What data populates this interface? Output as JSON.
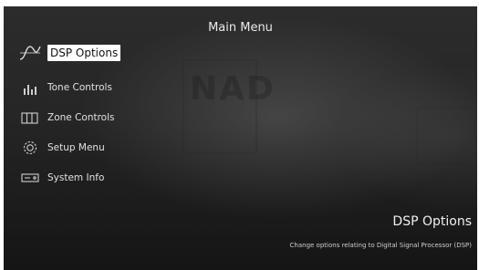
{
  "screen": {
    "title": "Main Menu"
  },
  "menu": {
    "items": [
      {
        "label": "DSP Options",
        "icon": "waveform-icon",
        "selected": true
      },
      {
        "label": "Tone Controls",
        "icon": "equalizer-icon",
        "selected": false
      },
      {
        "label": "Zone Controls",
        "icon": "zones-icon",
        "selected": false
      },
      {
        "label": "Setup Menu",
        "icon": "gear-icon",
        "selected": false
      },
      {
        "label": "System Info",
        "icon": "device-icon",
        "selected": false
      }
    ]
  },
  "description": {
    "title": "DSP Options",
    "text": "Change options relating to Digital Signal Processor (DSP)"
  },
  "background": {
    "logo_text": "NAD"
  },
  "colors": {
    "background": "#1f1f1f",
    "text": "#e2e2e2",
    "selection": "#ffffff"
  }
}
